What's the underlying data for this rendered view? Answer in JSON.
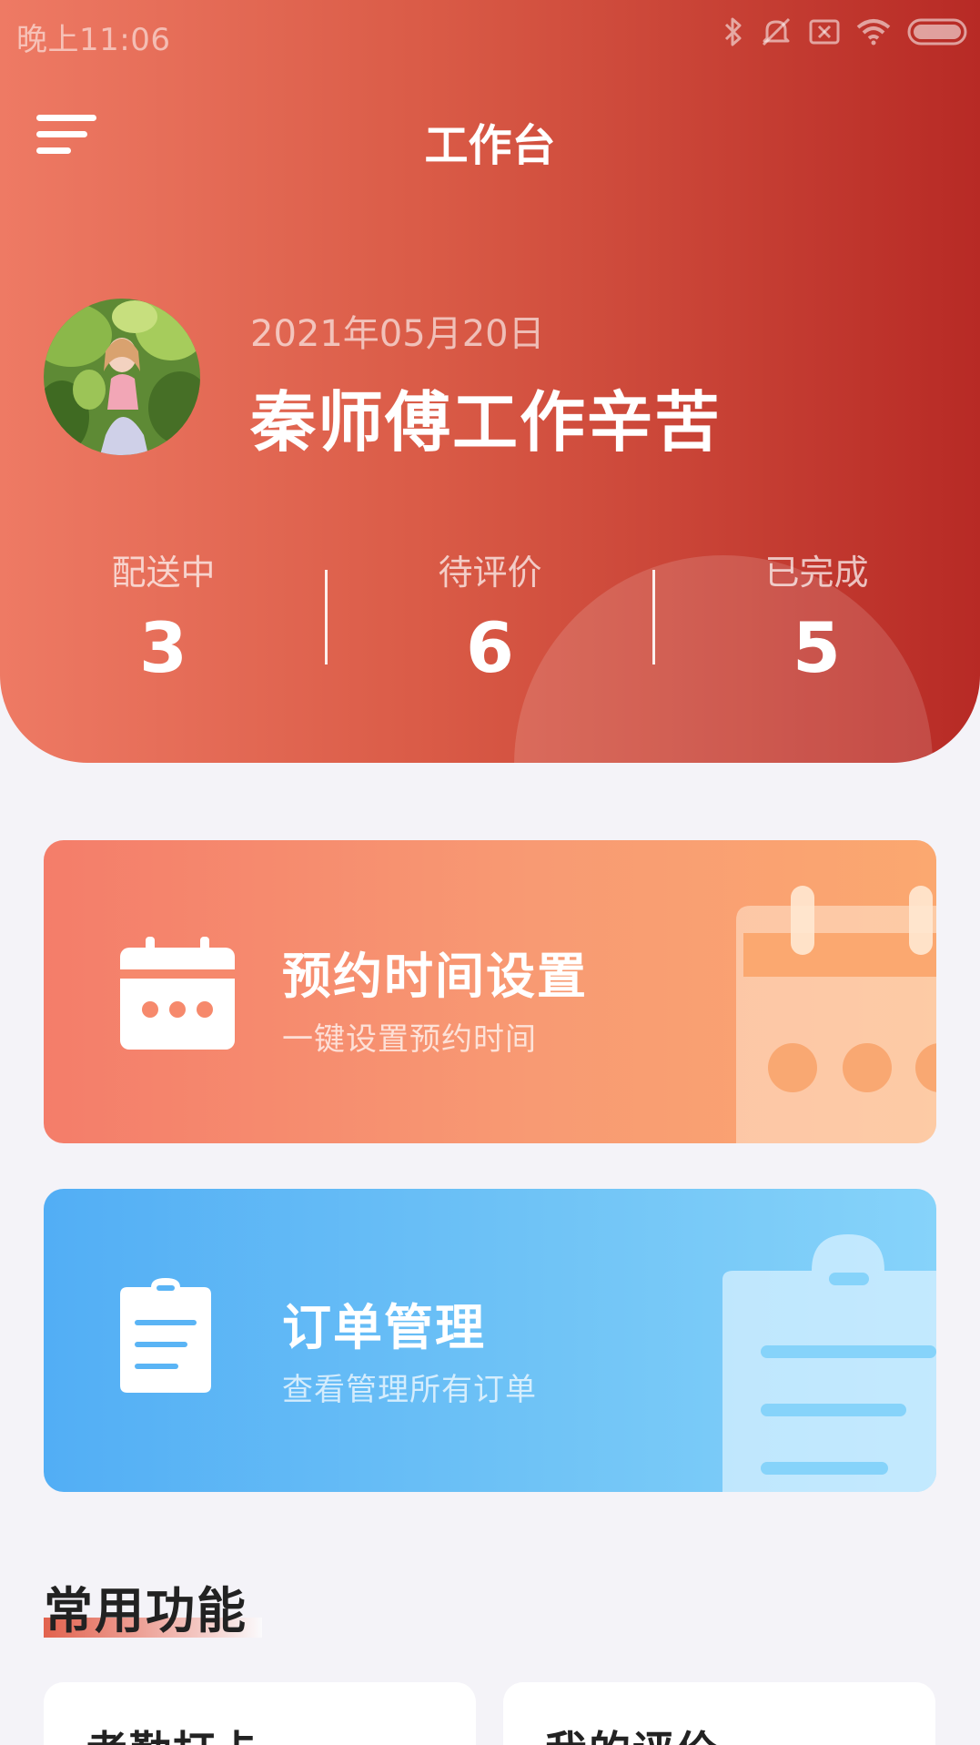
{
  "status_bar": {
    "time": "晚上11:06",
    "icons": [
      "bluetooth-icon",
      "mute-icon",
      "sim-off-icon",
      "wifi-icon",
      "battery-icon"
    ]
  },
  "header": {
    "title": "工作台",
    "date": "2021年05月20日",
    "greeting": "秦师傅工作辛苦",
    "stats": [
      {
        "label": "配送中",
        "value": "3"
      },
      {
        "label": "待评价",
        "value": "6"
      },
      {
        "label": "已完成",
        "value": "5"
      }
    ]
  },
  "features": [
    {
      "title": "预约时间设置",
      "subtitle": "一键设置预约时间",
      "icon": "calendar-icon",
      "color": "#f47d6a"
    },
    {
      "title": "订单管理",
      "subtitle": "查看管理所有订单",
      "icon": "clipboard-icon",
      "color": "#52aef5"
    }
  ],
  "common": {
    "title": "常用功能",
    "items": [
      {
        "label": "考勤打卡"
      },
      {
        "label": "我的评价"
      }
    ]
  },
  "colors": {
    "header_start": "#ee7a64",
    "header_end": "#b72a25",
    "page_bg": "#f4f3f8"
  }
}
